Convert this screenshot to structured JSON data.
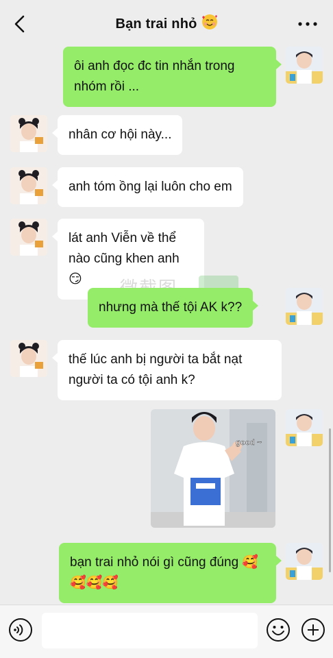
{
  "header": {
    "title": "Bạn trai nhỏ",
    "title_emoji": "🥰",
    "back_icon": "chevron-left-icon",
    "more_icon": "ellipsis-icon"
  },
  "messages": [
    {
      "side": "out",
      "text": "ôi anh đọc đc tin nhắn trong nhóm rồi ..."
    },
    {
      "side": "in",
      "text": "nhân cơ hội này..."
    },
    {
      "side": "in",
      "text": "anh tóm ồng lại luôn cho em"
    },
    {
      "side": "in",
      "text": "lát anh Viễn về thể nào cũng khen anh 😏"
    },
    {
      "side": "out",
      "text": "nhưng mà thế tội AK k??"
    },
    {
      "side": "in",
      "text": "thế lúc anh bị người ta bắt nạt người ta có tội anh k?"
    },
    {
      "side": "out",
      "type": "image",
      "caption": "good ~"
    },
    {
      "side": "out",
      "text": "bạn trai nhỏ nói gì cũng đúng 🥰🥰🥰🥰"
    }
  ],
  "watermark": "微截图",
  "input": {
    "placeholder": ""
  },
  "colors": {
    "out_bubble": "#95ec69",
    "in_bubble": "#ffffff",
    "background": "#ededed"
  }
}
